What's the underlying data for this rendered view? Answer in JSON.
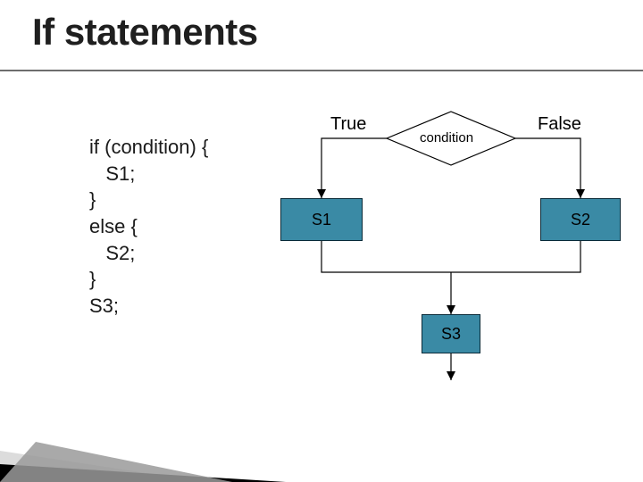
{
  "title": "If statements",
  "code": {
    "l1": "if (condition) {",
    "l2": "   S1;",
    "l3": "}",
    "l4": "else {",
    "l5": "   S2;",
    "l6": "}",
    "l7": "S3;"
  },
  "diagram": {
    "condition": "condition",
    "true_label": "True",
    "false_label": "False",
    "s1": "S1",
    "s2": "S2",
    "s3": "S3"
  },
  "colors": {
    "box_fill": "#3a8aa5",
    "box_stroke": "#0a2a38",
    "line": "#000000"
  }
}
